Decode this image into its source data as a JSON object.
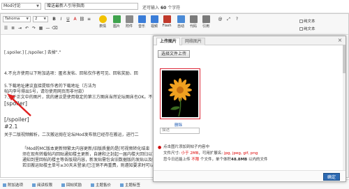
{
  "topbar": {
    "forum_select": "Mod讨论",
    "title": "赠送最新人引导指南",
    "char_hint_prefix": "还可输入",
    "char_count": "60",
    "char_hint_suffix": "个字符"
  },
  "toolbar": {
    "font": "Tahoma",
    "size": "2",
    "format_buttons": [
      "B",
      "I",
      "U",
      "A",
      "⛓",
      "≡"
    ],
    "big_buttons": [
      {
        "label": "表情",
        "icon": "smiley-icon",
        "color": "#f2c200"
      },
      {
        "label": "图片",
        "icon": "image-icon",
        "color": "#3fa34d"
      },
      {
        "label": "附件",
        "icon": "attachment-icon",
        "color": "#8a8a8a"
      },
      {
        "label": "音乐",
        "icon": "music-icon",
        "color": "#3b7dd8"
      },
      {
        "label": "视频",
        "icon": "video-icon",
        "color": "#3b7dd8"
      },
      {
        "label": "Flash",
        "icon": "flash-icon",
        "color": "#c0392b"
      },
      {
        "label": "自动",
        "icon": "auto-icon",
        "color": "#4a8ad6"
      },
      {
        "label": "代码",
        "icon": "code-icon",
        "color": "#7a7a7a"
      },
      {
        "label": "引用",
        "icon": "quote-icon",
        "color": "#7a7a7a"
      }
    ],
    "checkbox_label": "纯文本"
  },
  "content": {
    "lines": [
      "[.spoiler.] [./spoiler.] 去掉\".\"",
      "4.不允许使用以下附加选项：匿名发帖、回帖仅作者可见、回帖奖励、回",
      "5.下载地址建议直接提取作者的下载地址（方法为",
      "帖内李号得出5号，请勿使用网页而非付款）",
      "7.关于正文中的图片，我的建议是使用稳定的第三方图床当然论坛图床也OK。不",
      "[spoiler]",
      "[/spoiler]",
      "#2.1",
      "关于二版视频解析，二次搬运抛在论坛Mod发布就已经存在搬运，进行二",
      "「Mod的MC版本更新频繁太内容更新/旧版质量的是[可视频转化结束",
      "须在现有转载帖内回贴通知楼主更新，自建和之封起一届内楼大回归以下",
      "通知到里回帖的楼主等各版规内容，新发贴需包含旧数据版的发贴以及转",
      "若旧搬运贴楼主单号≥30天未登录/已注销不再重费，则遵知要求时可以"
    ]
  },
  "dialog": {
    "tab_upload": "上传图片",
    "tab_network": "网络图片",
    "upload_button": "选择文件上传",
    "delete_link": "删除",
    "desc_placeholder": "描述",
    "info_line1": "点击图片添加到帖子内容中",
    "info_line2_prefix": "文件尺寸: ",
    "info_line2_size": "小于 2MB",
    "info_line2_mid": "，可用扩展名: ",
    "info_line2_types": "jpg, jpeg, gif, png",
    "info_line3_prefix": "您今日还能上传 ",
    "info_line3_count": "不限",
    "info_line3_mid": " 个文件，单个体积",
    "info_line3_quota": "48.8MB",
    "info_line3_suffix": " 以内的文件",
    "ok_button": "确定"
  },
  "bottombar": {
    "items": [
      "附加选项",
      "阅读权限",
      "回帖奖励",
      "主题售价",
      "主题标签"
    ]
  }
}
